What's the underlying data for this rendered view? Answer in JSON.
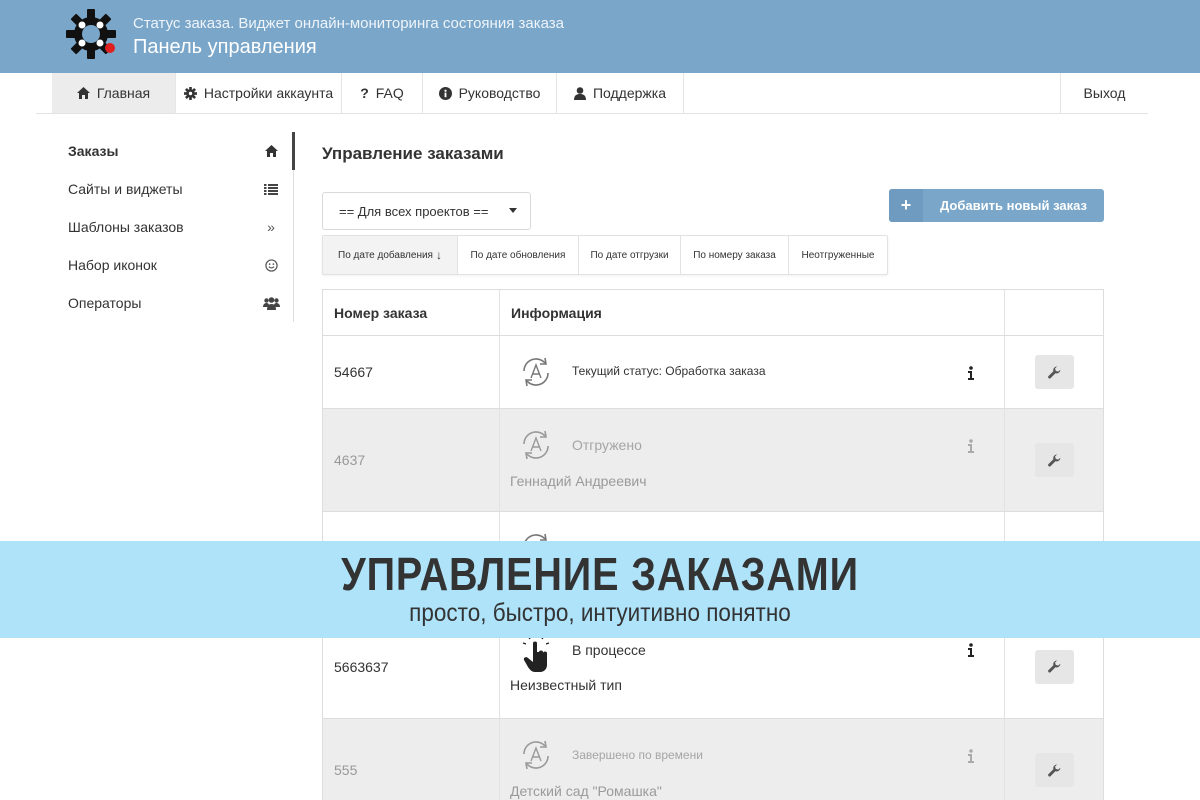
{
  "header": {
    "subtitle": "Статус заказа. Виджет онлайн-мониторинга состояния заказа",
    "title": "Панель управления"
  },
  "nav": {
    "items": [
      {
        "label": "Главная",
        "icon": "home-icon"
      },
      {
        "label": "Настройки аккаунта",
        "icon": "gear-icon"
      },
      {
        "label": "FAQ",
        "icon": "question-icon"
      },
      {
        "label": "Руководство",
        "icon": "info-circle-icon"
      },
      {
        "label": "Поддержка",
        "icon": "user-icon"
      }
    ],
    "logout": "Выход"
  },
  "sidebar": {
    "items": [
      {
        "label": "Заказы",
        "icon": "home-icon"
      },
      {
        "label": "Сайты и виджеты",
        "icon": "list-icon"
      },
      {
        "label": "Шаблоны заказов",
        "icon": "double-chevron-icon"
      },
      {
        "label": "Набор иконок",
        "icon": "smile-icon"
      },
      {
        "label": "Операторы",
        "icon": "users-icon"
      }
    ]
  },
  "main": {
    "title": "Управление заказами",
    "project_select": "== Для всех проектов ==",
    "add_button": "Добавить новый заказ",
    "sort_tabs": [
      "По дате добавления",
      "По дате обновления",
      "По дате отгрузки",
      "По номеру заказа",
      "Неотгруженные"
    ],
    "sort_arrow": "↓"
  },
  "table": {
    "headers": [
      "Номер заказа",
      "Информация",
      ""
    ],
    "rows": [
      {
        "number": "54667",
        "status": "Текущий статус: Обработка заказа",
        "sub": ""
      },
      {
        "number": "4637",
        "status": "Отгружено",
        "sub": "Геннадий Андреевич"
      },
      {
        "number": "",
        "status": "",
        "sub": ""
      },
      {
        "number": "5663637",
        "status": "В процессе",
        "sub": "Неизвестный тип"
      },
      {
        "number": "555",
        "status": "Завершено по времени",
        "sub": "Детский сад \"Ромашка\""
      }
    ]
  },
  "banner": {
    "title": "УПРАВЛЕНИЕ ЗАКАЗАМИ",
    "subtitle": "просто, быстро, интуитивно понятно"
  },
  "colors": {
    "header_bg": "#7aa6c9",
    "banner_bg": "#aee3fa",
    "button_bg": "#7aa6c9"
  }
}
